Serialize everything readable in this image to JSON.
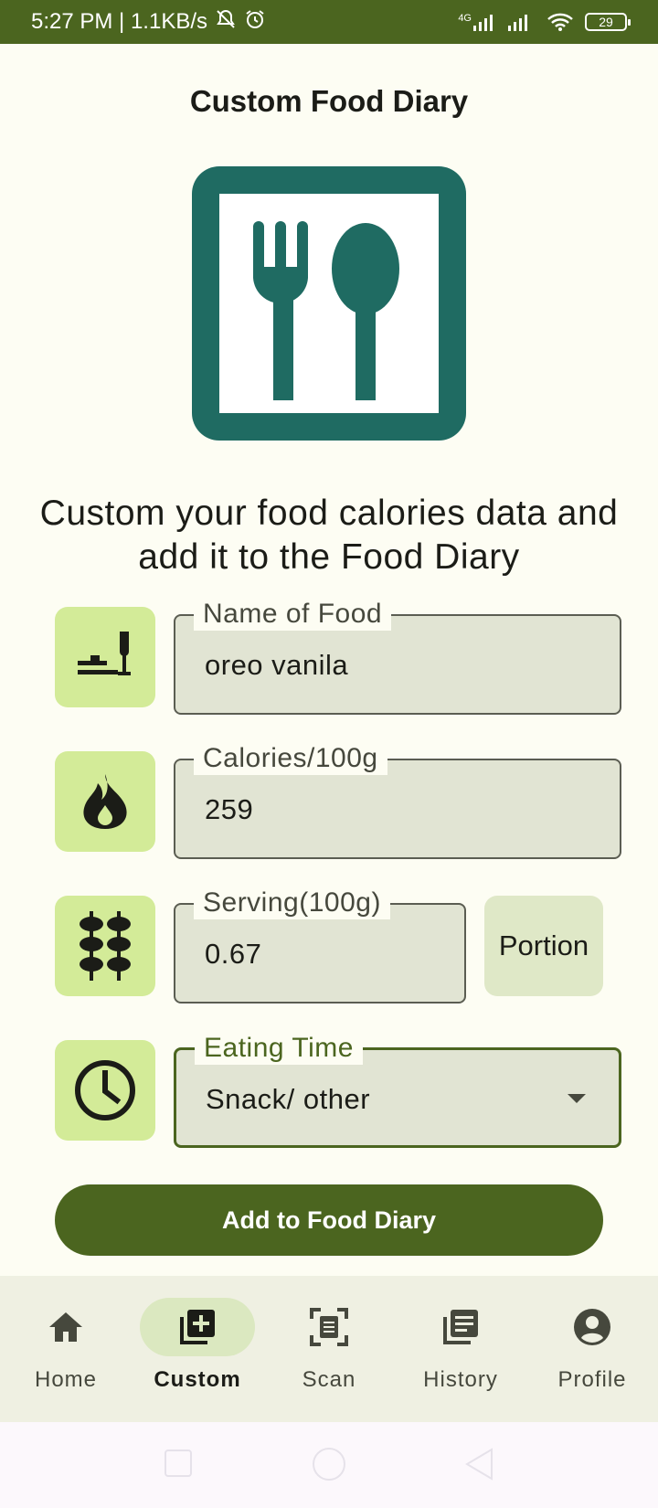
{
  "status_bar": {
    "time_speed": "5:27 PM | 1.1KB/s",
    "network": "4G",
    "battery": "29"
  },
  "page": {
    "title": "Custom Food Diary",
    "headline": "Custom your food calories data and add it to the Food Diary"
  },
  "form": {
    "name": {
      "label": "Name of Food",
      "value": "oreo vanila",
      "icon": "dining-icon"
    },
    "calories": {
      "label": "Calories/100g",
      "value": "259",
      "icon": "fire-icon"
    },
    "serving": {
      "label": "Serving(100g)",
      "value": "0.67",
      "icon": "kebab-icon"
    },
    "portion_label": "Portion",
    "eating_time": {
      "label": "Eating Time",
      "value": "Snack/ other",
      "icon": "clock-icon"
    },
    "submit_label": "Add to Food Diary"
  },
  "bottom_nav": {
    "items": [
      {
        "label": "Home",
        "icon": "home-icon",
        "active": false
      },
      {
        "label": "Custom",
        "icon": "add-box-icon",
        "active": true
      },
      {
        "label": "Scan",
        "icon": "scan-icon",
        "active": false
      },
      {
        "label": "History",
        "icon": "history-icon",
        "active": false
      },
      {
        "label": "Profile",
        "icon": "profile-icon",
        "active": false
      }
    ]
  },
  "colors": {
    "primary": "#4b651f",
    "hero_icon": "#1f6b62",
    "chip_bg": "#d3eb98",
    "field_bg": "#e1e4d3",
    "background": "#fdfdf3"
  }
}
